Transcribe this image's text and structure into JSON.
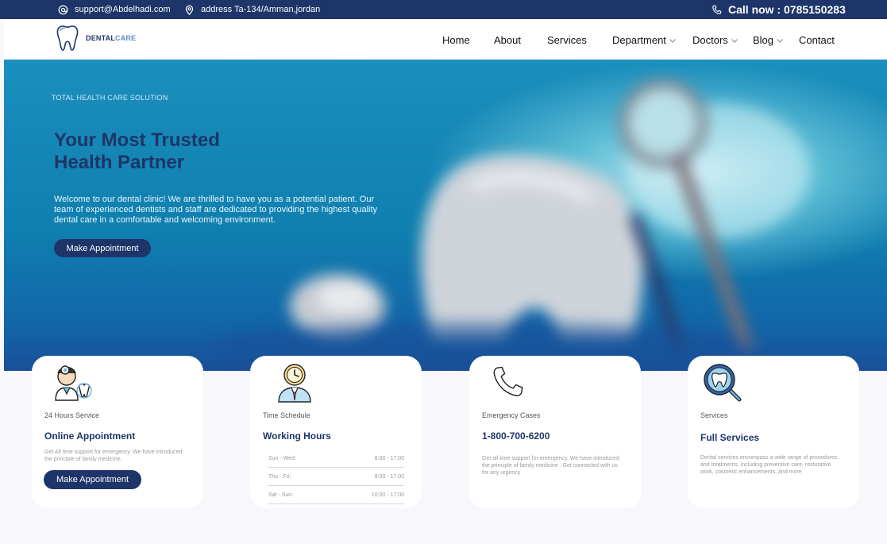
{
  "topbar": {
    "email": "support@Abdelhadi.com",
    "address": "address Ta-134/Amman,jordan",
    "call": "Call now : 0785150283"
  },
  "brand": {
    "name_part1": "DENTAL",
    "name_part2": "CARE"
  },
  "nav": {
    "home": "Home",
    "about": "About",
    "services": "Services",
    "department": "Department",
    "doctors": "Doctors",
    "blog": "Blog",
    "contact": "Contact"
  },
  "hero": {
    "subtitle": "TOTAL HEALTH CARE SOLUTION",
    "title_line1": "Your Most Trusted",
    "title_line2": "Health Partner",
    "description": "Welcome to our dental clinic! We are thrilled to have you as a potential patient. Our team of experienced dentists and staff are dedicated to providing the highest quality dental care in a comfortable and welcoming environment.",
    "cta": "Make Appointment"
  },
  "cards": [
    {
      "icon": "dentist-icon",
      "label": "24 Hours Service",
      "heading": "Online Appointment",
      "body": "Get All time support for emergency. We have introduced the principle of family medicine.",
      "button": "Make Appointment"
    },
    {
      "icon": "clock-doctor-icon",
      "label": "Time Schedule",
      "heading": "Working Hours",
      "hours": [
        {
          "day": "Sun - Wed:",
          "time": "8:00 - 17:00"
        },
        {
          "day": "Thu - Fri:",
          "time": "9:00 - 17:00"
        },
        {
          "day": "Sat - Sun:",
          "time": "10:00 - 17:00"
        }
      ]
    },
    {
      "icon": "phone-icon",
      "label": "Emergency Cases",
      "heading": "1-800-700-6200",
      "body": "Get all time support for emergency. We have introduced the principle of family medicine . Get connected with us for any urgency"
    },
    {
      "icon": "tooth-magnifier-icon",
      "label": "Services",
      "heading": "Full Services",
      "body": "Dental services encompass a wide range of procedures and treatments, including preventive care, restorative work, cosmetic enhancements, and more"
    }
  ],
  "colors": {
    "navy": "#1d3568",
    "hero_blue": "#0f7fb0",
    "page_bg": "#f7f7fc"
  }
}
